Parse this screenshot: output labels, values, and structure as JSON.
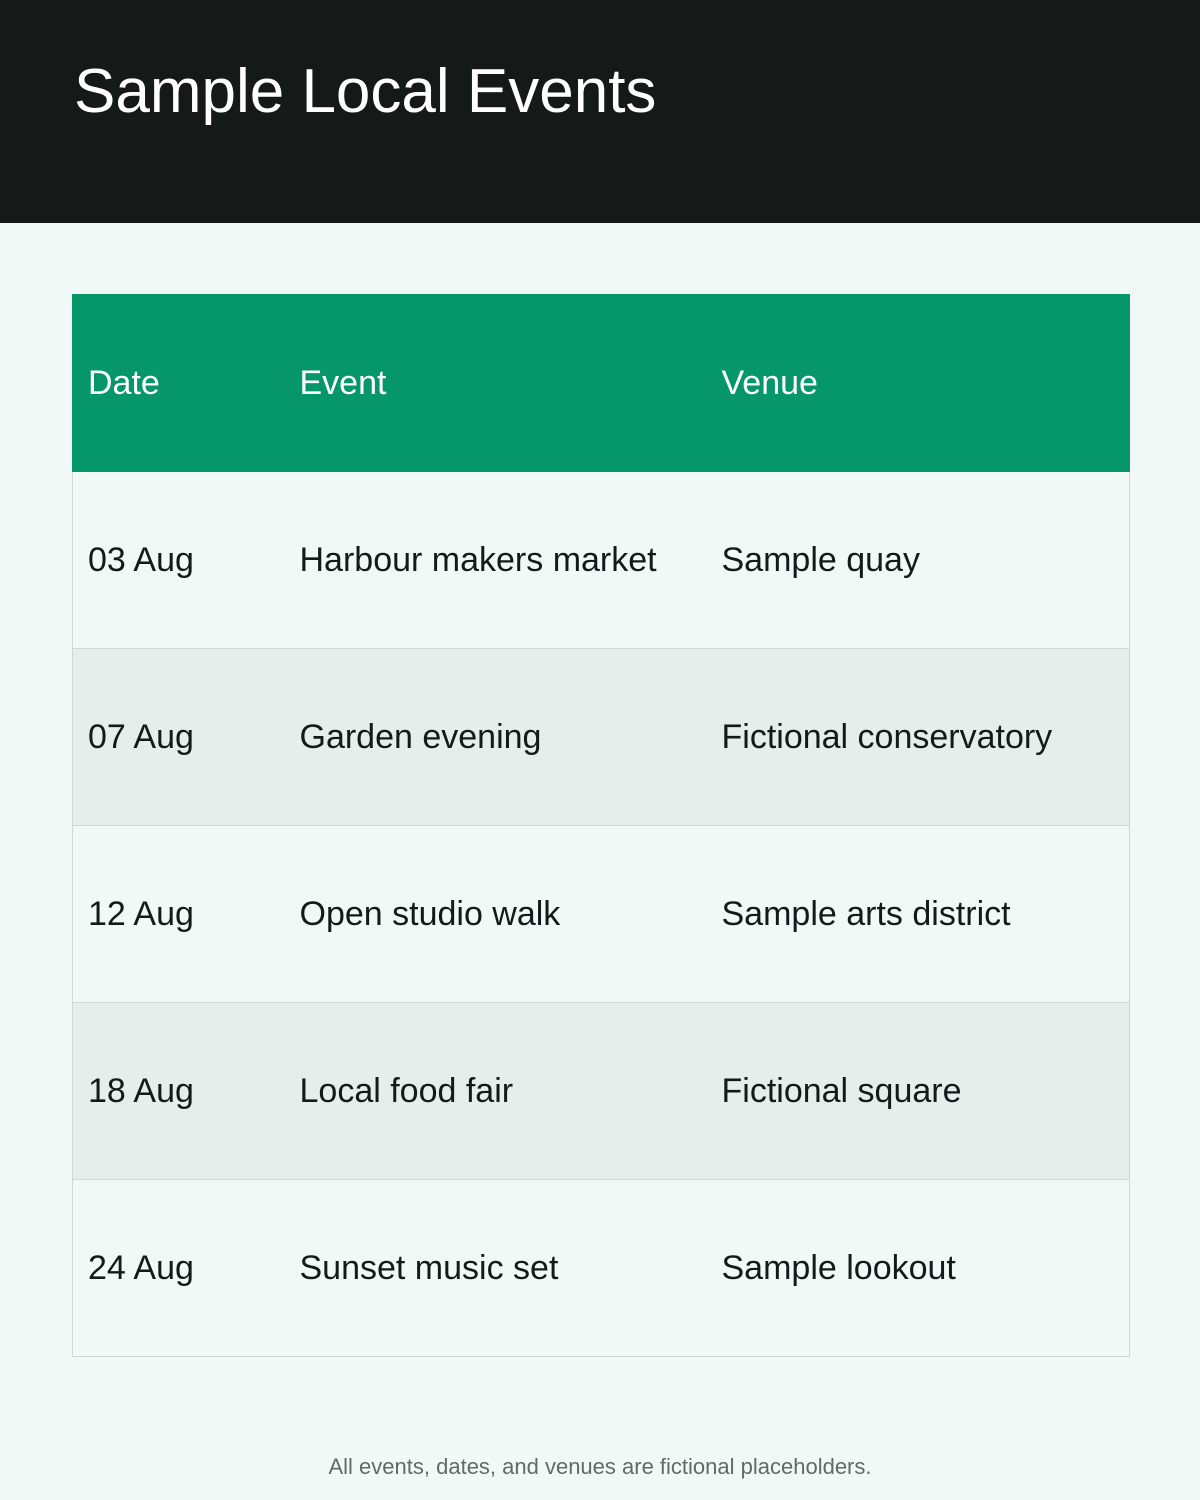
{
  "header": {
    "title": "Sample Local Events"
  },
  "table": {
    "columns": [
      "Date",
      "Event",
      "Venue"
    ],
    "rows": [
      {
        "date": "03 Aug",
        "event": "Harbour makers market",
        "venue": "Sample quay"
      },
      {
        "date": "07 Aug",
        "event": "Garden evening",
        "venue": "Fictional conservatory"
      },
      {
        "date": "12 Aug",
        "event": "Open studio walk",
        "venue": "Sample arts district"
      },
      {
        "date": "18 Aug",
        "event": "Local food fair",
        "venue": "Fictional square"
      },
      {
        "date": "24 Aug",
        "event": "Sunset music set",
        "venue": "Sample lookout"
      }
    ]
  },
  "footnote": "All events, dates, and venues are fictional placeholders.",
  "colors": {
    "header_bg": "#151a19",
    "accent": "#05966a",
    "page_bg": "#f1f9f6",
    "row_alt_bg": "#e5eeeb"
  }
}
